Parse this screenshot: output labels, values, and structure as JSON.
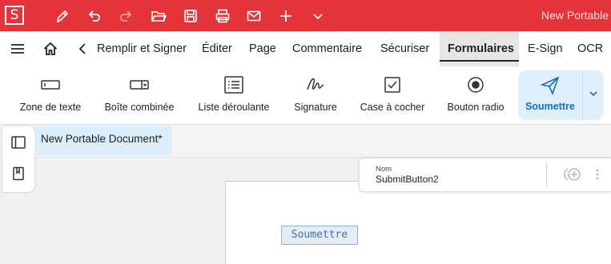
{
  "app": {
    "logo_letter": "S",
    "title": "New Portable"
  },
  "quick_access": [
    {
      "name": "pen-icon"
    },
    {
      "name": "undo-icon"
    },
    {
      "name": "redo-icon"
    },
    {
      "name": "open-folder-icon"
    },
    {
      "name": "save-icon"
    },
    {
      "name": "print-icon"
    },
    {
      "name": "mail-icon"
    },
    {
      "name": "plus-icon"
    },
    {
      "name": "chevron-down-icon"
    }
  ],
  "menu": {
    "tabs": [
      {
        "label": "Remplir et Signer"
      },
      {
        "label": "Éditer"
      },
      {
        "label": "Page"
      },
      {
        "label": "Commentaire"
      },
      {
        "label": "Sécuriser"
      },
      {
        "label": "Formulaires",
        "active": true
      },
      {
        "label": "E-Sign"
      },
      {
        "label": "OCR"
      }
    ]
  },
  "ribbon": {
    "buttons": [
      {
        "label": "Zone de texte",
        "icon": "textbox-icon"
      },
      {
        "label": "Boîte combinée",
        "icon": "combobox-icon"
      },
      {
        "label": "Liste déroulante",
        "icon": "listbox-icon"
      },
      {
        "label": "Signature",
        "icon": "signature-icon"
      },
      {
        "label": "Case à cocher",
        "icon": "checkbox-icon"
      },
      {
        "label": "Bouton radio",
        "icon": "radio-icon"
      },
      {
        "label": "Soumettre",
        "icon": "send-icon",
        "selected": true
      }
    ]
  },
  "document": {
    "tab_title": "New Portable Document*"
  },
  "field": {
    "label": "Soumettre"
  },
  "properties": {
    "key": "Nom",
    "value": "SubmitButton2"
  },
  "colors": {
    "title_bar": "#e3333b",
    "accent": "#1670b8",
    "selected_bg": "#dff0fb"
  }
}
